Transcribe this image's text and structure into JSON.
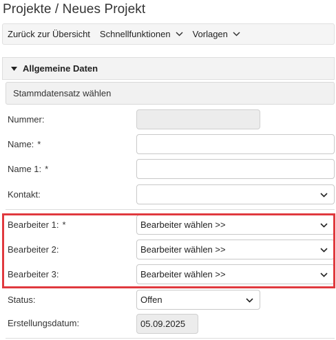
{
  "page": {
    "title": "Projekte / Neues Projekt"
  },
  "toolbar": {
    "back": "Zurück zur Übersicht",
    "quick": "Schnellfunktionen",
    "templates": "Vorlagen"
  },
  "section": {
    "title": "Allgemeine Daten"
  },
  "stammdaten": {
    "label": "Stammdatensatz wählen"
  },
  "fields": {
    "nummer": {
      "label": "Nummer:",
      "value": ""
    },
    "name": {
      "label": "Name:",
      "required": "*",
      "value": ""
    },
    "name1": {
      "label": "Name 1:",
      "required": "*",
      "value": ""
    },
    "kontakt": {
      "label": "Kontakt:",
      "value": ""
    },
    "bearbeiter1": {
      "label": "Bearbeiter 1:",
      "required": "*",
      "value": "Bearbeiter wählen >>"
    },
    "bearbeiter2": {
      "label": "Bearbeiter 2:",
      "value": "Bearbeiter wählen >>"
    },
    "bearbeiter3": {
      "label": "Bearbeiter 3:",
      "value": "Bearbeiter wählen >>"
    },
    "status": {
      "label": "Status:",
      "value": "Offen"
    },
    "erstellungsdatum": {
      "label": "Erstellungsdatum:",
      "value": "05.09.2025"
    }
  },
  "colors": {
    "highlight": "#e0393e"
  },
  "icons": {
    "dropdown": "chevron-down-icon",
    "section_toggle": "caret-down-icon"
  }
}
